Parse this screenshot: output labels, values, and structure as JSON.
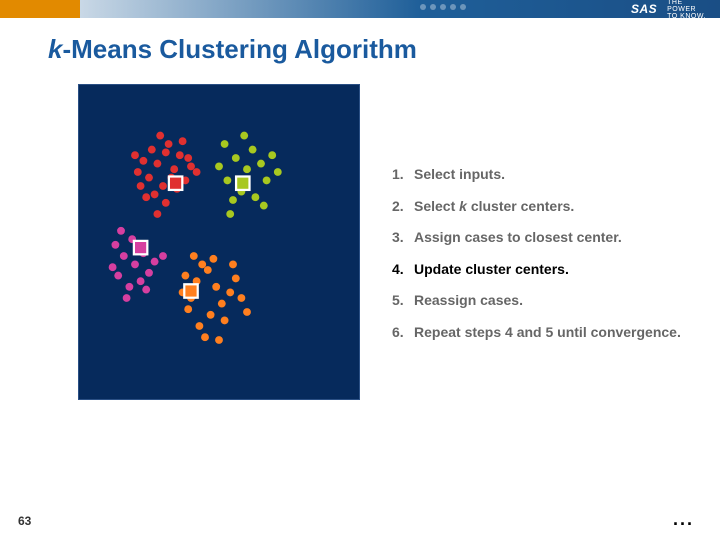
{
  "brand": {
    "logo": "SAS",
    "tagline1": "THE",
    "tagline2": "POWER",
    "tagline3": "TO KNOW."
  },
  "title": {
    "prefix": "k",
    "rest": "-Means Clustering Algorithm"
  },
  "steps": [
    {
      "n": "1.",
      "text": "Select inputs.",
      "active": false
    },
    {
      "n": "2.",
      "text_pre": "Select ",
      "k": "k",
      "text_post": " cluster centers.",
      "active": false
    },
    {
      "n": "3.",
      "text": "Assign cases to closest center.",
      "active": false
    },
    {
      "n": "4.",
      "text": "Update cluster centers.",
      "active": true
    },
    {
      "n": "5.",
      "text": "Reassign cases.",
      "active": false
    },
    {
      "n": "6.",
      "text": "Repeat steps 4 and 5 until convergence.",
      "active": false
    }
  ],
  "page_number": "63",
  "ellipsis": "...",
  "chart_data": {
    "type": "scatter",
    "title": "k-means clustering illustration",
    "xlim": [
      0,
      100
    ],
    "ylim": [
      0,
      100
    ],
    "series": [
      {
        "name": "cluster-red",
        "color": "#e03030",
        "points": [
          [
            28,
            22
          ],
          [
            31,
            18
          ],
          [
            25,
            27
          ],
          [
            34,
            24
          ],
          [
            30,
            30
          ],
          [
            23,
            21
          ],
          [
            36,
            19
          ],
          [
            27,
            33
          ],
          [
            38,
            28
          ],
          [
            32,
            15
          ],
          [
            21,
            25
          ],
          [
            35,
            31
          ],
          [
            29,
            12
          ],
          [
            40,
            23
          ],
          [
            26,
            17
          ],
          [
            33,
            27
          ],
          [
            22,
            30
          ],
          [
            37,
            14
          ],
          [
            24,
            34
          ],
          [
            39,
            20
          ],
          [
            31,
            36
          ],
          [
            28,
            40
          ],
          [
            20,
            19
          ],
          [
            42,
            25
          ]
        ]
      },
      {
        "name": "cluster-magenta",
        "color": "#d63fa0",
        "points": [
          [
            16,
            55
          ],
          [
            20,
            58
          ],
          [
            14,
            62
          ],
          [
            23,
            54
          ],
          [
            18,
            66
          ],
          [
            12,
            59
          ],
          [
            25,
            61
          ],
          [
            21,
            52
          ],
          [
            17,
            70
          ],
          [
            27,
            57
          ],
          [
            13,
            51
          ],
          [
            22,
            64
          ],
          [
            30,
            55
          ],
          [
            19,
            49
          ],
          [
            24,
            67
          ],
          [
            15,
            46
          ]
        ]
      },
      {
        "name": "cluster-green",
        "color": "#a8c820",
        "points": [
          [
            56,
            20
          ],
          [
            60,
            24
          ],
          [
            53,
            28
          ],
          [
            62,
            17
          ],
          [
            58,
            32
          ],
          [
            65,
            22
          ],
          [
            55,
            35
          ],
          [
            67,
            28
          ],
          [
            52,
            15
          ],
          [
            63,
            34
          ],
          [
            59,
            12
          ],
          [
            69,
            19
          ],
          [
            54,
            40
          ],
          [
            66,
            37
          ],
          [
            71,
            25
          ],
          [
            50,
            23
          ]
        ]
      },
      {
        "name": "cluster-orange",
        "color": "#ff7f1f",
        "points": [
          [
            42,
            64
          ],
          [
            46,
            60
          ],
          [
            40,
            70
          ],
          [
            49,
            66
          ],
          [
            44,
            58
          ],
          [
            38,
            62
          ],
          [
            51,
            72
          ],
          [
            47,
            76
          ],
          [
            43,
            80
          ],
          [
            54,
            68
          ],
          [
            39,
            74
          ],
          [
            48,
            56
          ],
          [
            56,
            63
          ],
          [
            45,
            84
          ],
          [
            52,
            78
          ],
          [
            58,
            70
          ],
          [
            41,
            55
          ],
          [
            60,
            75
          ],
          [
            50,
            85
          ],
          [
            37,
            68
          ],
          [
            55,
            58
          ]
        ]
      }
    ],
    "centers": [
      {
        "name": "center-red",
        "color": "#e03030",
        "x": 34.5,
        "y": 29
      },
      {
        "name": "center-magenta",
        "color": "#d63fa0",
        "x": 22,
        "y": 52
      },
      {
        "name": "center-green",
        "color": "#a8c820",
        "x": 58.5,
        "y": 29
      },
      {
        "name": "center-orange",
        "color": "#ff7f1f",
        "x": 40,
        "y": 67.5
      }
    ]
  }
}
